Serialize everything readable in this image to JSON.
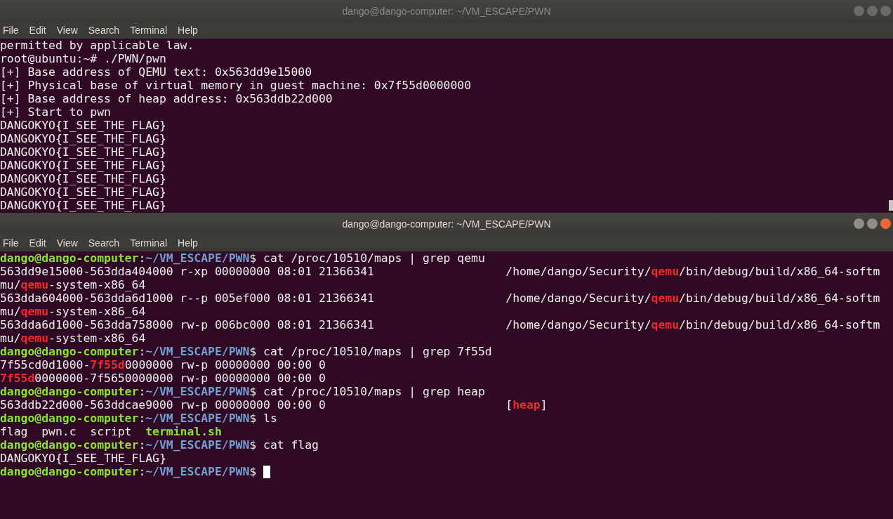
{
  "windows": [
    {
      "title": "dango@dango-computer: ~/VM_ESCAPE/PWN",
      "active": false,
      "menu": [
        "File",
        "Edit",
        "View",
        "Search",
        "Terminal",
        "Help"
      ],
      "scrollbar": true,
      "lines": [
        {
          "segments": [
            {
              "kind": "text",
              "text": "permitted by applicable law."
            }
          ]
        },
        {
          "segments": [
            {
              "kind": "text",
              "text": "root@ubuntu:~# ./PWN/pwn"
            }
          ]
        },
        {
          "segments": [
            {
              "kind": "text",
              "text": "[+] Base address of QEMU text: 0x563dd9e15000"
            }
          ]
        },
        {
          "segments": [
            {
              "kind": "text",
              "text": "[+] Physical base of virtual memory in guest machine: 0x7f55d0000000"
            }
          ]
        },
        {
          "segments": [
            {
              "kind": "text",
              "text": "[+] Base address of heap address: 0x563ddb22d000"
            }
          ]
        },
        {
          "segments": [
            {
              "kind": "text",
              "text": "[+] Start to pwn"
            }
          ]
        },
        {
          "segments": [
            {
              "kind": "text",
              "text": "DANGOKYO{I_SEE_THE_FLAG}"
            }
          ]
        },
        {
          "segments": [
            {
              "kind": "text",
              "text": "DANGOKYO{I_SEE_THE_FLAG}"
            }
          ]
        },
        {
          "segments": [
            {
              "kind": "text",
              "text": "DANGOKYO{I_SEE_THE_FLAG}"
            }
          ]
        },
        {
          "segments": [
            {
              "kind": "text",
              "text": "DANGOKYO{I_SEE_THE_FLAG}"
            }
          ]
        },
        {
          "segments": [
            {
              "kind": "text",
              "text": "DANGOKYO{I_SEE_THE_FLAG}"
            }
          ]
        },
        {
          "segments": [
            {
              "kind": "text",
              "text": "DANGOKYO{I_SEE_THE_FLAG}"
            }
          ]
        },
        {
          "segments": [
            {
              "kind": "text",
              "text": "DANGOKYO{I_SEE_THE_FLAG}"
            }
          ]
        }
      ]
    },
    {
      "title": "dango@dango-computer: ~/VM_ESCAPE/PWN",
      "active": true,
      "menu": [
        "File",
        "Edit",
        "View",
        "Search",
        "Terminal",
        "Help"
      ],
      "scrollbar": false,
      "lines": [
        {
          "segments": [
            {
              "kind": "user",
              "text": "dango@dango-computer"
            },
            {
              "kind": "text",
              "text": ":"
            },
            {
              "kind": "path",
              "text": "~/VM_ESCAPE/PWN"
            },
            {
              "kind": "text",
              "text": "$ cat /proc/10510/maps | grep qemu"
            }
          ]
        },
        {
          "segments": [
            {
              "kind": "text",
              "text": "563dd9e15000-563dda404000 r-xp 00000000 08:01 21366341                   /home/dango/Security/"
            },
            {
              "kind": "match",
              "text": "qemu"
            },
            {
              "kind": "text",
              "text": "/bin/debug/build/x86_64-softm"
            }
          ]
        },
        {
          "segments": [
            {
              "kind": "text",
              "text": "mu/"
            },
            {
              "kind": "match",
              "text": "qemu"
            },
            {
              "kind": "text",
              "text": "-system-x86_64"
            }
          ]
        },
        {
          "segments": [
            {
              "kind": "text",
              "text": "563dda604000-563dda6d1000 r--p 005ef000 08:01 21366341                   /home/dango/Security/"
            },
            {
              "kind": "match",
              "text": "qemu"
            },
            {
              "kind": "text",
              "text": "/bin/debug/build/x86_64-softm"
            }
          ]
        },
        {
          "segments": [
            {
              "kind": "text",
              "text": "mu/"
            },
            {
              "kind": "match",
              "text": "qemu"
            },
            {
              "kind": "text",
              "text": "-system-x86_64"
            }
          ]
        },
        {
          "segments": [
            {
              "kind": "text",
              "text": "563dda6d1000-563dda758000 rw-p 006bc000 08:01 21366341                   /home/dango/Security/"
            },
            {
              "kind": "match",
              "text": "qemu"
            },
            {
              "kind": "text",
              "text": "/bin/debug/build/x86_64-softm"
            }
          ]
        },
        {
          "segments": [
            {
              "kind": "text",
              "text": "mu/"
            },
            {
              "kind": "match",
              "text": "qemu"
            },
            {
              "kind": "text",
              "text": "-system-x86_64"
            }
          ]
        },
        {
          "segments": [
            {
              "kind": "user",
              "text": "dango@dango-computer"
            },
            {
              "kind": "text",
              "text": ":"
            },
            {
              "kind": "path",
              "text": "~/VM_ESCAPE/PWN"
            },
            {
              "kind": "text",
              "text": "$ cat /proc/10510/maps | grep 7f55d"
            }
          ]
        },
        {
          "segments": [
            {
              "kind": "text",
              "text": "7f55cd0d1000-"
            },
            {
              "kind": "match",
              "text": "7f55d"
            },
            {
              "kind": "text",
              "text": "0000000 rw-p 00000000 00:00 0"
            }
          ]
        },
        {
          "segments": [
            {
              "kind": "match",
              "text": "7f55d"
            },
            {
              "kind": "text",
              "text": "0000000-7f5650000000 rw-p 00000000 00:00 0"
            }
          ]
        },
        {
          "segments": [
            {
              "kind": "user",
              "text": "dango@dango-computer"
            },
            {
              "kind": "text",
              "text": ":"
            },
            {
              "kind": "path",
              "text": "~/VM_ESCAPE/PWN"
            },
            {
              "kind": "text",
              "text": "$ cat /proc/10510/maps | grep heap"
            }
          ]
        },
        {
          "segments": [
            {
              "kind": "text",
              "text": "563ddb22d000-563ddcae9000 rw-p 00000000 00:00 0                          ["
            },
            {
              "kind": "match",
              "text": "heap"
            },
            {
              "kind": "text",
              "text": "]"
            }
          ]
        },
        {
          "segments": [
            {
              "kind": "user",
              "text": "dango@dango-computer"
            },
            {
              "kind": "text",
              "text": ":"
            },
            {
              "kind": "path",
              "text": "~/VM_ESCAPE/PWN"
            },
            {
              "kind": "text",
              "text": "$ ls"
            }
          ]
        },
        {
          "segments": [
            {
              "kind": "text",
              "text": "flag  pwn.c  script  "
            },
            {
              "kind": "exec",
              "text": "terminal.sh"
            }
          ]
        },
        {
          "segments": [
            {
              "kind": "user",
              "text": "dango@dango-computer"
            },
            {
              "kind": "text",
              "text": ":"
            },
            {
              "kind": "path",
              "text": "~/VM_ESCAPE/PWN"
            },
            {
              "kind": "text",
              "text": "$ cat flag"
            }
          ]
        },
        {
          "segments": [
            {
              "kind": "text",
              "text": "DANGOKYO{I_SEE_THE_FLAG}"
            }
          ]
        },
        {
          "segments": [
            {
              "kind": "user",
              "text": "dango@dango-computer"
            },
            {
              "kind": "text",
              "text": ":"
            },
            {
              "kind": "path",
              "text": "~/VM_ESCAPE/PWN"
            },
            {
              "kind": "text",
              "text": "$ "
            },
            {
              "kind": "cursor"
            }
          ]
        }
      ]
    }
  ]
}
